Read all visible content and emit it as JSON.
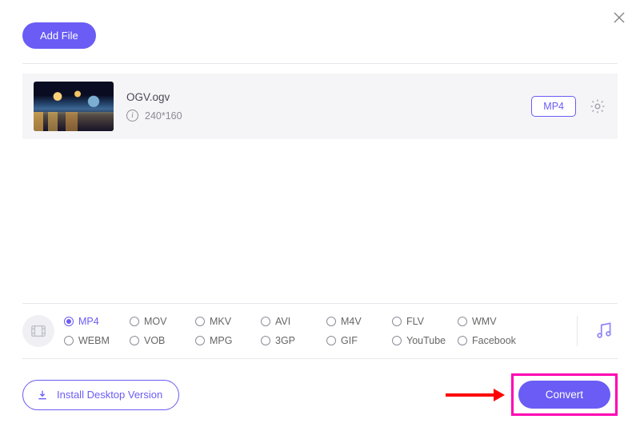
{
  "header": {
    "add_file_label": "Add File"
  },
  "file": {
    "name": "OGV.ogv",
    "resolution": "240*160",
    "target_format": "MP4"
  },
  "formats": {
    "row1": [
      "MP4",
      "MOV",
      "MKV",
      "AVI",
      "M4V",
      "FLV",
      "WMV"
    ],
    "row2": [
      "WEBM",
      "VOB",
      "MPG",
      "3GP",
      "GIF",
      "YouTube",
      "Facebook"
    ],
    "selected": "MP4"
  },
  "actions": {
    "install_label": "Install Desktop Version",
    "convert_label": "Convert"
  }
}
